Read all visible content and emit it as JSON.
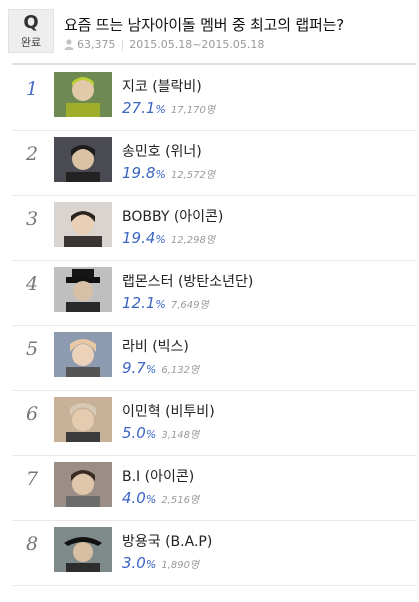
{
  "header": {
    "badge_q": "Q",
    "badge_status": "완료",
    "title": "요즘 뜨는 남자아이돌 멤버 중 최고의 랩퍼는?",
    "participants": "63,375",
    "period": "2015.05.18~2015.05.18"
  },
  "results": [
    {
      "rank": "1",
      "name": "지코 (블락비)",
      "percent": "27.1",
      "votes": "17,170명"
    },
    {
      "rank": "2",
      "name": "송민호 (위너)",
      "percent": "19.8",
      "votes": "12,572명"
    },
    {
      "rank": "3",
      "name": "BOBBY (아이콘)",
      "percent": "19.4",
      "votes": "12,298명"
    },
    {
      "rank": "4",
      "name": "랩몬스터 (방탄소년단)",
      "percent": "12.1",
      "votes": "7,649명"
    },
    {
      "rank": "5",
      "name": "라비 (빅스)",
      "percent": "9.7",
      "votes": "6,132명"
    },
    {
      "rank": "6",
      "name": "이민혁 (비투비)",
      "percent": "5.0",
      "votes": "3,148명"
    },
    {
      "rank": "7",
      "name": "B.I (아이콘)",
      "percent": "4.0",
      "votes": "2,516명"
    },
    {
      "rank": "8",
      "name": "방용국 (B.A.P)",
      "percent": "3.0",
      "votes": "1,890명"
    }
  ],
  "percent_sign": "%",
  "colors": {
    "accent": "#3b64c4",
    "rank_first": "#4a6fc8"
  }
}
